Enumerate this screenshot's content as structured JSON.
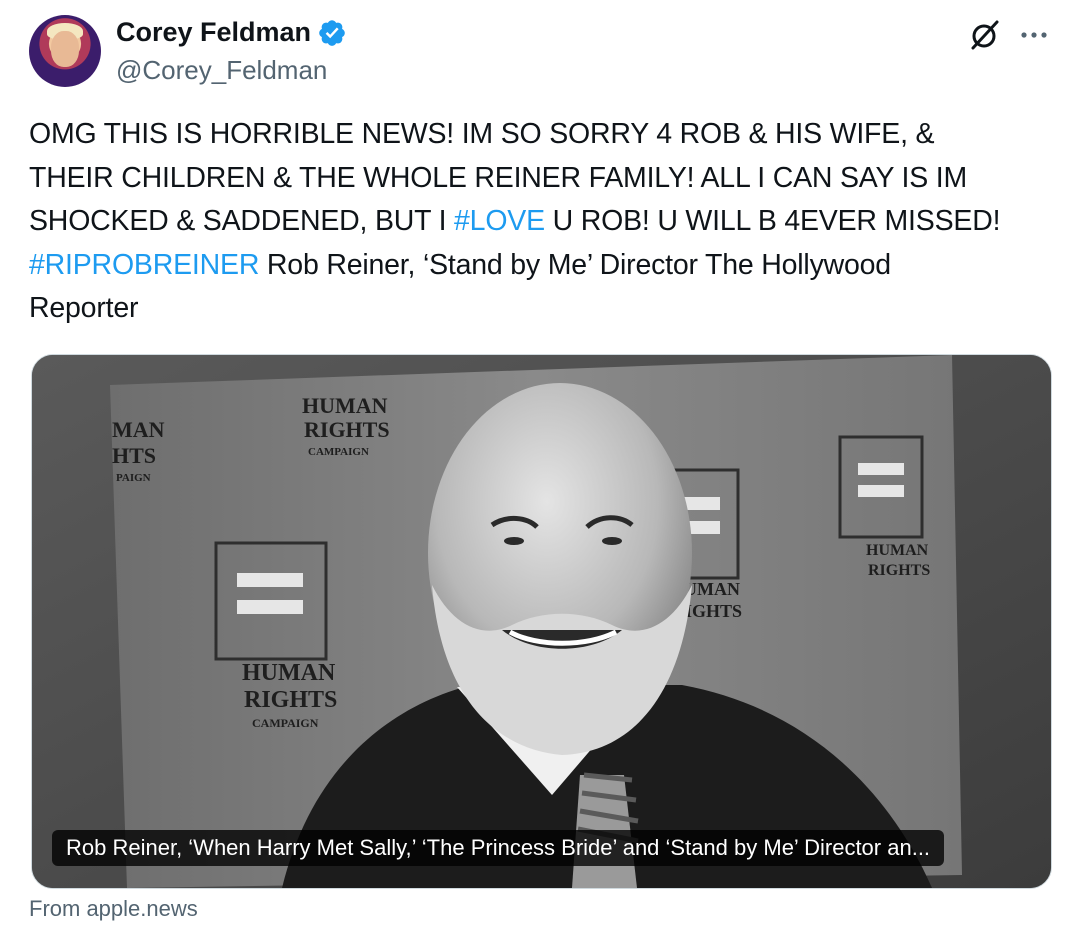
{
  "author": {
    "display_name": "Corey Feldman",
    "handle": "@Corey_Feldman",
    "verified": true,
    "verified_color": "#1d9bf0"
  },
  "tweet": {
    "lines": [
      [
        {
          "text": "OMG THIS IS HORRIBLE NEWS! IM SO SORRY 4 ROB & HIS WIFE, &",
          "hashtag": false
        }
      ],
      [
        {
          "text": "THEIR CHILDREN & THE WHOLE REINER FAMILY! ALL I CAN SAY IS IM",
          "hashtag": false
        }
      ],
      [
        {
          "text": "SHOCKED & SADDENED, BUT I ",
          "hashtag": false
        },
        {
          "text": "#LOVE",
          "hashtag": true
        },
        {
          "text": " U ROB! U WILL B 4EVER MISSED!",
          "hashtag": false
        }
      ],
      [
        {
          "text": "#RIPROBREINER",
          "hashtag": true
        },
        {
          "text": " Rob Reiner, ‘Stand by Me’ Director The Hollywood",
          "hashtag": false
        }
      ],
      [
        {
          "text": "Reporter",
          "hashtag": false
        }
      ]
    ],
    "hashtag_color": "#1d9bf0"
  },
  "media": {
    "caption": "Rob Reiner, ‘When Harry Met Sally,’ ‘The Princess Bride’ and ‘Stand by Me’ Director an...",
    "backdrop_text": [
      "HUMAN",
      "RIGHTS",
      "CAMPAIGN"
    ]
  },
  "card": {
    "source": "From apple.news"
  },
  "icons": {
    "verified": "verified-badge-icon",
    "grok": "grok-icon",
    "more": "more-options-icon"
  }
}
